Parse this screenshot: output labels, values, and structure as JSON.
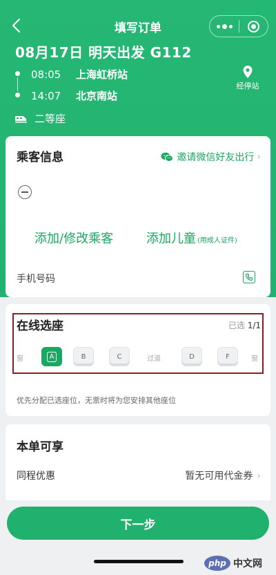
{
  "nav": {
    "title": "填写订单"
  },
  "trip": {
    "title": "08月17日  明天出发  G112",
    "departure": {
      "time": "08:05",
      "station": "上海虹桥站"
    },
    "arrival": {
      "time": "14:07",
      "station": "北京南站"
    },
    "stops_label": "经停站",
    "seat_class": "二等座"
  },
  "passenger": {
    "title": "乘客信息",
    "invite_label": "邀请微信好友出行",
    "add_passenger_label": "添加/修改乘客",
    "add_child_label": "添加儿童",
    "add_child_note": "(用成人证件)",
    "phone_label": "手机号码"
  },
  "seat_selection": {
    "title": "在线选座",
    "selected_prefix": "已选 ",
    "selected_count": "1/1",
    "window_label": "窗",
    "aisle_label": "过道",
    "seats": [
      "A",
      "B",
      "C",
      "D",
      "F"
    ],
    "selected_seat": "A",
    "note": "优先分配已选座位，无票时将为您安排其他座位"
  },
  "benefits": {
    "title": "本单可享",
    "row_label": "同程优惠",
    "row_value": "暂无可用代金券"
  },
  "footer": {
    "next_label": "下一步"
  },
  "watermark": {
    "logo": "php",
    "text": "中文网"
  },
  "colors": {
    "brand_green": "#22b26f",
    "highlight_border": "#8b1b24"
  }
}
